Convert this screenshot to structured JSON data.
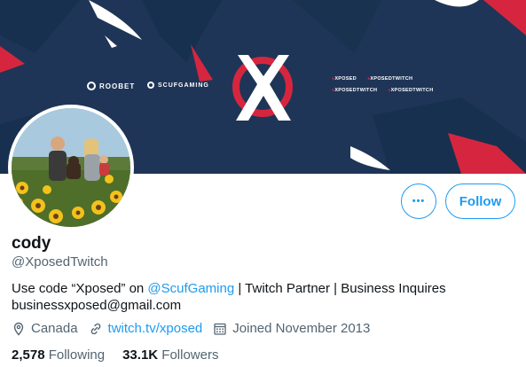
{
  "banner": {
    "sponsors": [
      "ROOBET",
      "SCUFGAMING"
    ],
    "socials_row1": [
      "XPOSED",
      "XPOSEDTWITCH"
    ],
    "socials_row2": [
      "XPOSEDTWITCH",
      "XPOSEDTWITCH"
    ],
    "colors": {
      "background": "#1e3557",
      "accent": "#d6263f",
      "highlight": "#ffffff"
    }
  },
  "profile": {
    "display_name": "cody",
    "handle": "@XposedTwitch",
    "bio_prefix": "Use code “Xposed” on ",
    "bio_mention": "@ScufGaming",
    "bio_suffix": " | Twitch Partner | Business Inquires",
    "bio_line2": "businessxposed@gmail.com",
    "location": "Canada",
    "website": "twitch.tv/xposed",
    "joined": "Joined November 2013",
    "following_count": "2,578",
    "following_label": "Following",
    "followers_count": "33.1K",
    "followers_label": "Followers"
  },
  "actions": {
    "more_label": "•••",
    "follow_label": "Follow"
  },
  "icons": {
    "more": "more-horizontal-icon",
    "location": "location-pin-icon",
    "website": "link-icon",
    "joined": "calendar-icon"
  },
  "theme": {
    "link": "#1d9bf0",
    "text": "#0f1419",
    "secondary": "#536471"
  }
}
